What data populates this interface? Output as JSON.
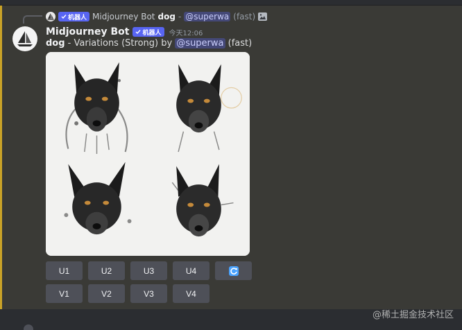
{
  "reply": {
    "author": "Midjourney Bot",
    "bot_label": "机器人",
    "prompt_word": "dog",
    "separator": "-",
    "mention": "@superwa",
    "mode": "(fast)"
  },
  "message": {
    "author": "Midjourney Bot",
    "bot_label": "机器人",
    "timestamp": "今天12:06",
    "prompt_word": "dog",
    "description": " - Variations (Strong) by ",
    "mention": "@superwa",
    "mode": " (fast)"
  },
  "buttons": {
    "upscale": [
      "U1",
      "U2",
      "U3",
      "U4"
    ],
    "variation": [
      "V1",
      "V2",
      "V3",
      "V4"
    ]
  },
  "watermark": "@稀土掘金技术社区",
  "colors": {
    "accent": "#5865f2",
    "mention_bar": "#c9a227",
    "refresh_icon": "#4aa3ff"
  },
  "icons": [
    "checkmark-icon",
    "image-icon",
    "refresh-icon",
    "sailboat-avatar-icon"
  ]
}
